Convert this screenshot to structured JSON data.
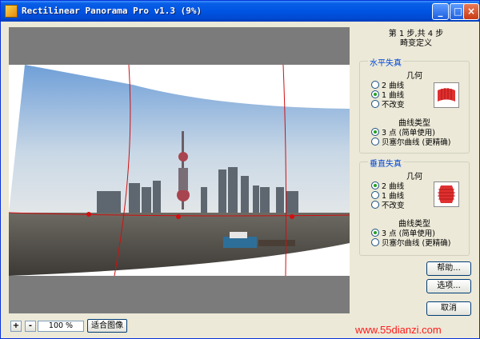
{
  "window": {
    "title": "Rectilinear Panorama Pro v1.3 (9%)",
    "min_glyph": "_",
    "max_glyph": "□",
    "close_glyph": "×"
  },
  "steps": {
    "line1": "第 1 步,共 4 步",
    "line2": "畸变定义"
  },
  "horizontal": {
    "legend": "水平失真",
    "geometry_title": "几何",
    "geometry_options": [
      "2 曲线",
      "1 曲线",
      "不改变"
    ],
    "geometry_selected": 1,
    "curve_title": "曲线类型",
    "curve_options": [
      "3 点 (简单使用)",
      "贝塞尔曲线 (更精确)"
    ],
    "curve_selected": 0
  },
  "vertical": {
    "legend": "垂直失真",
    "geometry_title": "几何",
    "geometry_options": [
      "2 曲线",
      "1 曲线",
      "不改变"
    ],
    "geometry_selected": 0,
    "curve_title": "曲线类型",
    "curve_options": [
      "3 点 (简单使用)",
      "贝塞尔曲线 (更精确)"
    ],
    "curve_selected": 0
  },
  "buttons": {
    "help": "帮助...",
    "options": "选项...",
    "cancel": "取消"
  },
  "bottom": {
    "zoom_in": "+",
    "zoom_out": "-",
    "zoom_value": "100 %",
    "fit": "适合图像"
  },
  "watermark": "www.55dianzi.com",
  "colors": {
    "title_bar": "#0054e3",
    "guide_line": "#d01010",
    "accent_label": "#0046d5",
    "watermark": "#ff1a1a"
  }
}
